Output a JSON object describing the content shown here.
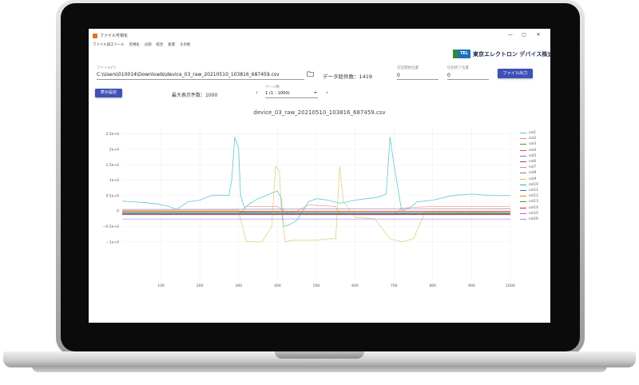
{
  "window": {
    "title": "ファイル可視化",
    "minimize": "—",
    "maximize": "▢",
    "close": "✕"
  },
  "menu": [
    "ファイル加工ツール",
    "可視化",
    "分割",
    "結合",
    "処理",
    "その他"
  ],
  "logo": {
    "mark": "TEL",
    "company": "東京エレクトロン デバイス株式会社"
  },
  "file": {
    "label": "ファイル(*)",
    "path": "C:\\Users\\010014\\Downloads\\device_03_raw_20210510_103816_687459.csv"
  },
  "total_count": "データ総件数：1419",
  "cut_start": {
    "label": "切出開始位置",
    "value": "0"
  },
  "cut_end": {
    "label": "切出終了位置",
    "value": "0"
  },
  "export_button": "ファイル出力",
  "display_settings_button": "表示設定",
  "max_display": "最大表示件数：1000",
  "page": {
    "label": "ページ数",
    "value": "1 (1 - 1000)",
    "prev": "‹",
    "next": "›"
  },
  "chart_data": {
    "type": "line",
    "title": "device_03_raw_20210510_103816_687459.csv",
    "xlim": [
      0,
      1000
    ],
    "ylim": [
      -22500.0,
      27500.0
    ],
    "x_ticks": [
      "100",
      "200",
      "300",
      "400",
      "500",
      "600",
      "700",
      "800",
      "900",
      "1000"
    ],
    "y_ticks": [
      {
        "value": 25000,
        "label": "2.5e+4"
      },
      {
        "value": 20000,
        "label": "2e+4"
      },
      {
        "value": 15000,
        "label": "1.5e+4"
      },
      {
        "value": 10000,
        "label": "1e+4"
      },
      {
        "value": 5000,
        "label": "0.5e+4"
      },
      {
        "value": 0,
        "label": "0"
      },
      {
        "value": -5000,
        "label": "−0.5e+4"
      },
      {
        "value": -10000,
        "label": "−1e+4"
      }
    ],
    "legend_position": "right",
    "grid": true,
    "series": [
      {
        "name": "col1",
        "color": "#5bc8d8",
        "points": [
          [
            0,
            3200
          ],
          [
            30,
            3000
          ],
          [
            60,
            2700
          ],
          [
            90,
            2300
          ],
          [
            120,
            1500
          ],
          [
            140,
            500
          ],
          [
            170,
            3000
          ],
          [
            200,
            3500
          ],
          [
            230,
            5000
          ],
          [
            260,
            5200
          ],
          [
            275,
            5000
          ],
          [
            282,
            10000
          ],
          [
            290,
            24000
          ],
          [
            300,
            20000
          ],
          [
            305,
            5000
          ],
          [
            315,
            1000
          ],
          [
            330,
            2500
          ],
          [
            350,
            4000
          ],
          [
            380,
            5500
          ],
          [
            400,
            6500
          ],
          [
            410,
            4000
          ],
          [
            415,
            -5000
          ],
          [
            430,
            -4500
          ],
          [
            450,
            -3000
          ],
          [
            470,
            1000
          ],
          [
            480,
            3000
          ],
          [
            500,
            4000
          ],
          [
            530,
            3500
          ],
          [
            560,
            2500
          ],
          [
            600,
            3500
          ],
          [
            630,
            4000
          ],
          [
            660,
            4500
          ],
          [
            680,
            5500
          ],
          [
            690,
            24000
          ],
          [
            700,
            15000
          ],
          [
            720,
            0
          ],
          [
            740,
            1000
          ],
          [
            760,
            3000
          ],
          [
            800,
            3500
          ],
          [
            850,
            5000
          ],
          [
            900,
            5500
          ],
          [
            950,
            5000
          ],
          [
            1000,
            5000
          ]
        ]
      },
      {
        "name": "col2",
        "color": "#f08c80",
        "points": [
          [
            0,
            200
          ],
          [
            300,
            300
          ],
          [
            305,
            -500
          ],
          [
            320,
            1500
          ],
          [
            400,
            1500
          ],
          [
            430,
            -1000
          ],
          [
            450,
            0
          ],
          [
            480,
            2000
          ],
          [
            550,
            1500
          ],
          [
            560,
            -1000
          ],
          [
            600,
            -1200
          ],
          [
            700,
            -1200
          ],
          [
            720,
            1000
          ],
          [
            800,
            1500
          ],
          [
            1000,
            1500
          ]
        ]
      },
      {
        "name": "col3",
        "color": "#33a033",
        "points": [
          [
            0,
            -500
          ],
          [
            500,
            -300
          ],
          [
            1000,
            -200
          ]
        ]
      },
      {
        "name": "col4",
        "color": "#e05050",
        "points": [
          [
            0,
            -200
          ],
          [
            1000,
            -100
          ]
        ]
      },
      {
        "name": "col5",
        "color": "#9467bd",
        "points": [
          [
            0,
            500
          ],
          [
            1000,
            700
          ]
        ]
      },
      {
        "name": "col6",
        "color": "#8c564b",
        "points": [
          [
            0,
            -300
          ],
          [
            1000,
            -250
          ]
        ]
      },
      {
        "name": "col7",
        "color": "#e377c2",
        "points": [
          [
            0,
            -100
          ],
          [
            1000,
            -50
          ]
        ]
      },
      {
        "name": "col8",
        "color": "#7f7f7f",
        "points": [
          [
            0,
            -600
          ],
          [
            1000,
            -600
          ]
        ]
      },
      {
        "name": "col9",
        "color": "#d4c45a",
        "points": [
          [
            0,
            -300
          ],
          [
            300,
            -300
          ],
          [
            320,
            -10000
          ],
          [
            360,
            -10000
          ],
          [
            385,
            -5000
          ],
          [
            395,
            14500
          ],
          [
            405,
            13000
          ],
          [
            410,
            0
          ],
          [
            420,
            -10000
          ],
          [
            440,
            -9500
          ],
          [
            460,
            -9500
          ],
          [
            500,
            -9500
          ],
          [
            530,
            -9000
          ],
          [
            550,
            -9000
          ],
          [
            560,
            14500
          ],
          [
            570,
            3000
          ],
          [
            600,
            -2000
          ],
          [
            650,
            -2500
          ],
          [
            690,
            -9000
          ],
          [
            720,
            -10000
          ],
          [
            750,
            -9000
          ],
          [
            780,
            -500
          ],
          [
            1000,
            -400
          ]
        ]
      },
      {
        "name": "col10",
        "color": "#17becf",
        "points": [
          [
            0,
            -800
          ],
          [
            1000,
            -800
          ]
        ]
      },
      {
        "name": "col11",
        "color": "#1f77b4",
        "points": [
          [
            0,
            -900
          ],
          [
            1000,
            -850
          ]
        ]
      },
      {
        "name": "col12",
        "color": "#ff7f0e",
        "points": [
          [
            0,
            -150
          ],
          [
            1000,
            -150
          ]
        ]
      },
      {
        "name": "col13",
        "color": "#2ca02c",
        "points": [
          [
            0,
            -1000
          ],
          [
            1000,
            -950
          ]
        ]
      },
      {
        "name": "col14",
        "color": "#d62728",
        "points": [
          [
            0,
            -1100
          ],
          [
            1000,
            -1050
          ]
        ]
      },
      {
        "name": "col15",
        "color": "#c95cc9",
        "points": [
          [
            0,
            -1200
          ],
          [
            1000,
            -1200
          ]
        ]
      },
      {
        "name": "col16",
        "color": "#a08ce0",
        "points": [
          [
            0,
            -2600
          ],
          [
            1000,
            -2600
          ]
        ]
      }
    ]
  }
}
